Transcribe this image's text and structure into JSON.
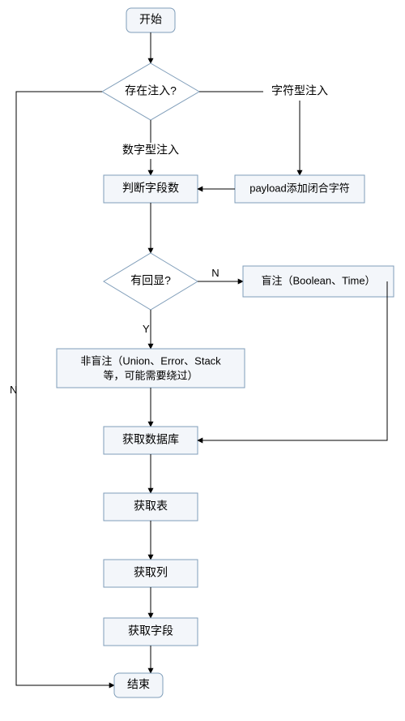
{
  "chart_data": {
    "type": "flowchart",
    "title": "",
    "nodes": [
      {
        "id": "start",
        "kind": "terminator",
        "label": "开始"
      },
      {
        "id": "d_inject",
        "kind": "decision",
        "label": "存在注入?"
      },
      {
        "id": "lbl_string",
        "kind": "text",
        "label": "字符型注入"
      },
      {
        "id": "lbl_num",
        "kind": "text",
        "label": "数字型注入"
      },
      {
        "id": "p_fields",
        "kind": "process",
        "label": "判断字段数"
      },
      {
        "id": "p_payload",
        "kind": "process",
        "label": "payload添加闭合字符"
      },
      {
        "id": "d_echo",
        "kind": "decision",
        "label": "有回显?"
      },
      {
        "id": "p_blind",
        "kind": "process",
        "label": "盲注（Boolean、Time）"
      },
      {
        "id": "p_nonblind",
        "kind": "process",
        "label": "非盲注（Union、Error、Stack等，可能需要绕过）"
      },
      {
        "id": "p_db",
        "kind": "process",
        "label": "获取数据库"
      },
      {
        "id": "p_table",
        "kind": "process",
        "label": "获取表"
      },
      {
        "id": "p_col",
        "kind": "process",
        "label": "获取列"
      },
      {
        "id": "p_field",
        "kind": "process",
        "label": "获取字段"
      },
      {
        "id": "end",
        "kind": "terminator",
        "label": "结束"
      }
    ],
    "edges": [
      {
        "from": "start",
        "to": "d_inject",
        "label": ""
      },
      {
        "from": "d_inject",
        "to": "lbl_string",
        "label": ""
      },
      {
        "from": "d_inject",
        "to": "p_fields",
        "label": "数字型注入"
      },
      {
        "from": "d_inject",
        "to": "end",
        "label": "N"
      },
      {
        "from": "lbl_string",
        "to": "p_payload",
        "label": ""
      },
      {
        "from": "p_payload",
        "to": "p_fields",
        "label": ""
      },
      {
        "from": "p_fields",
        "to": "d_echo",
        "label": ""
      },
      {
        "from": "d_echo",
        "to": "p_blind",
        "label": "N"
      },
      {
        "from": "d_echo",
        "to": "p_nonblind",
        "label": "Y"
      },
      {
        "from": "p_nonblind",
        "to": "p_db",
        "label": ""
      },
      {
        "from": "p_blind",
        "to": "p_db",
        "label": ""
      },
      {
        "from": "p_db",
        "to": "p_table",
        "label": ""
      },
      {
        "from": "p_table",
        "to": "p_col",
        "label": ""
      },
      {
        "from": "p_col",
        "to": "p_field",
        "label": ""
      },
      {
        "from": "p_field",
        "to": "end",
        "label": ""
      }
    ],
    "edge_labels": {
      "N": "N",
      "Y": "Y"
    }
  },
  "nodes": {
    "start": "开始",
    "d_inject": "存在注入?",
    "lbl_string": "字符型注入",
    "lbl_num": "数字型注入",
    "p_fields": "判断字段数",
    "p_payload": "payload添加闭合字符",
    "d_echo": "有回显?",
    "p_blind": "盲注（Boolean、Time）",
    "p_nonblind_line1": "非盲注（Union、Error、Stack",
    "p_nonblind_line2": "等，可能需要绕过）",
    "p_db": "获取数据库",
    "p_table": "获取表",
    "p_col": "获取列",
    "p_field": "获取字段",
    "end": "结束"
  },
  "labels": {
    "N": "N",
    "Y": "Y"
  },
  "watermark": ""
}
